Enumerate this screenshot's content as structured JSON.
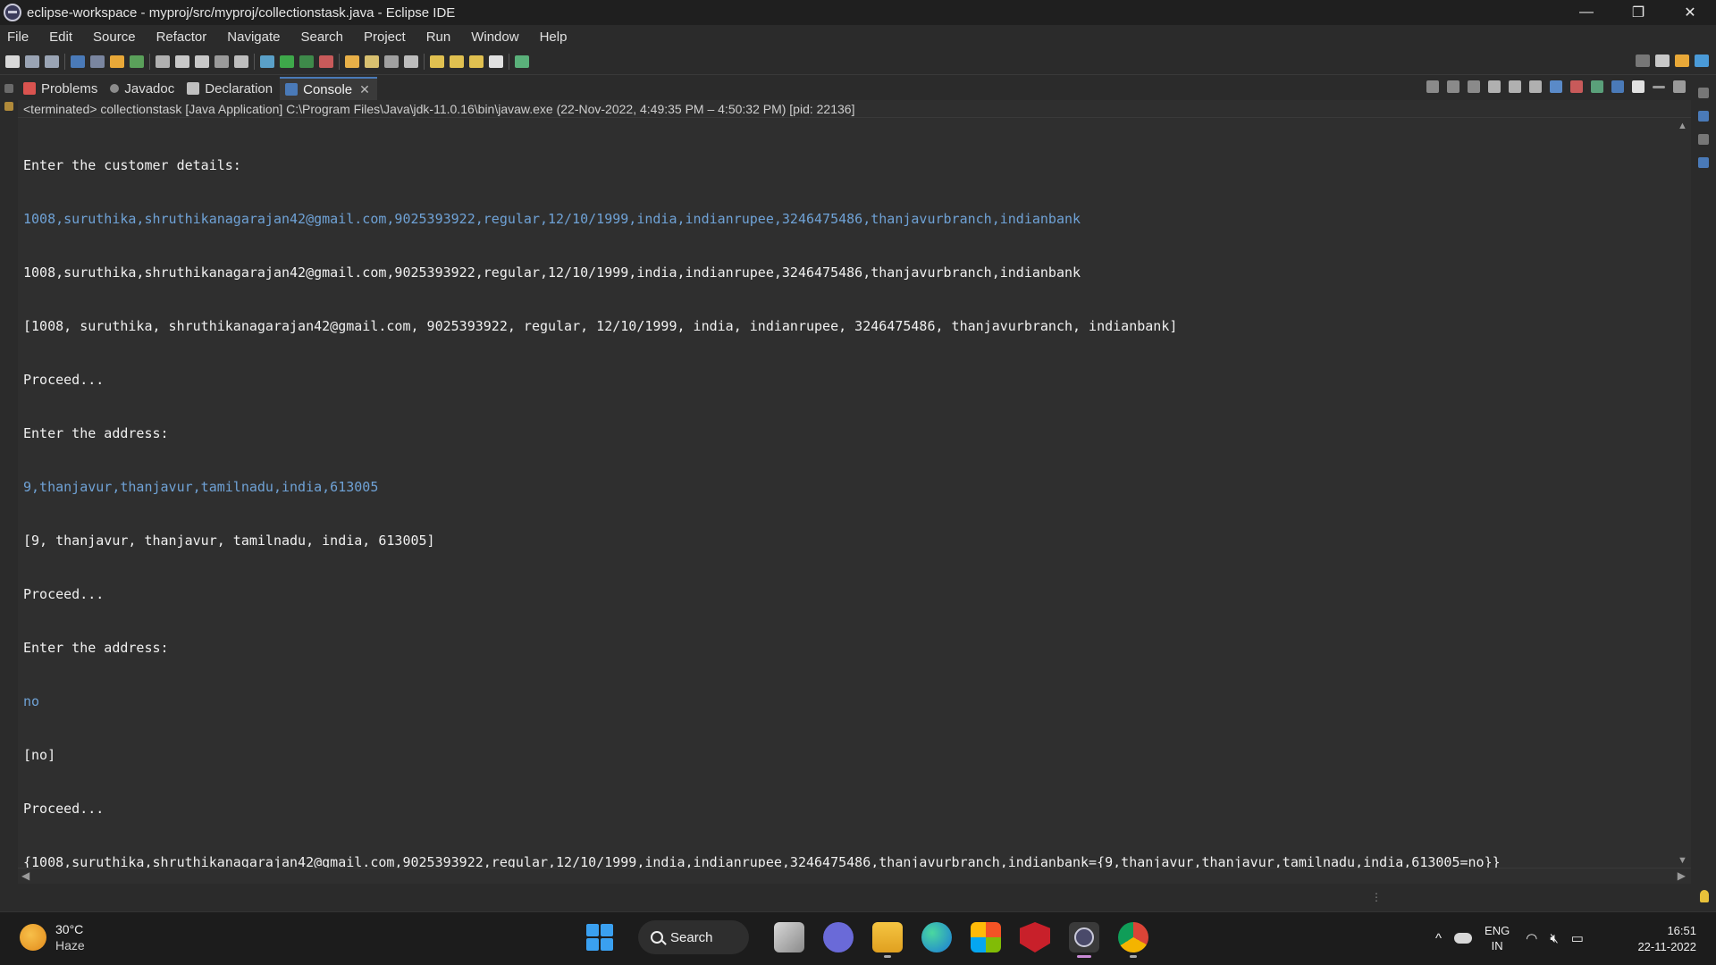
{
  "window": {
    "title": "eclipse-workspace - myproj/src/myproj/collectionstask.java - Eclipse IDE",
    "minimize": "—",
    "restore": "❐",
    "close": "✕"
  },
  "menu": [
    "File",
    "Edit",
    "Source",
    "Refactor",
    "Navigate",
    "Search",
    "Project",
    "Run",
    "Window",
    "Help"
  ],
  "tabs": [
    {
      "label": "Problems",
      "icon": "problems-icon",
      "color": "#d9534f"
    },
    {
      "label": "Javadoc",
      "icon": "javadoc-icon",
      "color": "#8c8c8c"
    },
    {
      "label": "Declaration",
      "icon": "declaration-icon",
      "color": "#c0c0c0"
    },
    {
      "label": "Console",
      "icon": "console-icon",
      "color": "#4a7ab8",
      "active": true,
      "close": "✕"
    }
  ],
  "status_line": "<terminated> collectionstask [Java Application] C:\\Program Files\\Java\\jdk-11.0.16\\bin\\javaw.exe  (22-Nov-2022, 4:49:35 PM – 4:50:32 PM) [pid: 22136]",
  "console_lines": [
    {
      "text": "Enter the customer details:",
      "kind": "out"
    },
    {
      "text": "1008,suruthika,shruthikanagarajan42@gmail.com,9025393922,regular,12/10/1999,india,indianrupee,3246475486,thanjavurbranch,indianbank",
      "kind": "in"
    },
    {
      "text": "1008,suruthika,shruthikanagarajan42@gmail.com,9025393922,regular,12/10/1999,india,indianrupee,3246475486,thanjavurbranch,indianbank",
      "kind": "out"
    },
    {
      "text": "[1008, suruthika, shruthikanagarajan42@gmail.com, 9025393922, regular, 12/10/1999, india, indianrupee, 3246475486, thanjavurbranch, indianbank]",
      "kind": "out"
    },
    {
      "text": "Proceed...",
      "kind": "out"
    },
    {
      "text": "Enter the address:",
      "kind": "out"
    },
    {
      "text": "9,thanjavur,thanjavur,tamilnadu,india,613005",
      "kind": "in"
    },
    {
      "text": "[9, thanjavur, thanjavur, tamilnadu, india, 613005]",
      "kind": "out"
    },
    {
      "text": "Proceed...",
      "kind": "out"
    },
    {
      "text": "Enter the address:",
      "kind": "out"
    },
    {
      "text": "no",
      "kind": "in"
    },
    {
      "text": "[no]",
      "kind": "out"
    },
    {
      "text": "Proceed...",
      "kind": "out"
    },
    {
      "text": "{1008,suruthika,shruthikanagarajan42@gmail.com,9025393922,regular,12/10/1999,india,indianrupee,3246475486,thanjavurbranch,indianbank={9,thanjavur,thanjavur,tamilnadu,india,613005=no}}",
      "kind": "out"
    }
  ],
  "colors": {
    "console_input": "#6fa2d6",
    "console_output": "#f0f0f0",
    "accent": "#4a7ab8"
  },
  "taskbar": {
    "weather_temp": "30°C",
    "weather_cond": "Haze",
    "search_label": "Search",
    "apps": [
      "task-view-icon",
      "teams-chat-icon",
      "file-explorer-icon",
      "edge-icon",
      "store-icon",
      "mcafee-icon",
      "eclipse-icon",
      "chrome-icon"
    ],
    "lang_line1": "ENG",
    "lang_line2": "IN",
    "time": "16:51",
    "date": "22-11-2022",
    "tray_chevron": "^"
  }
}
